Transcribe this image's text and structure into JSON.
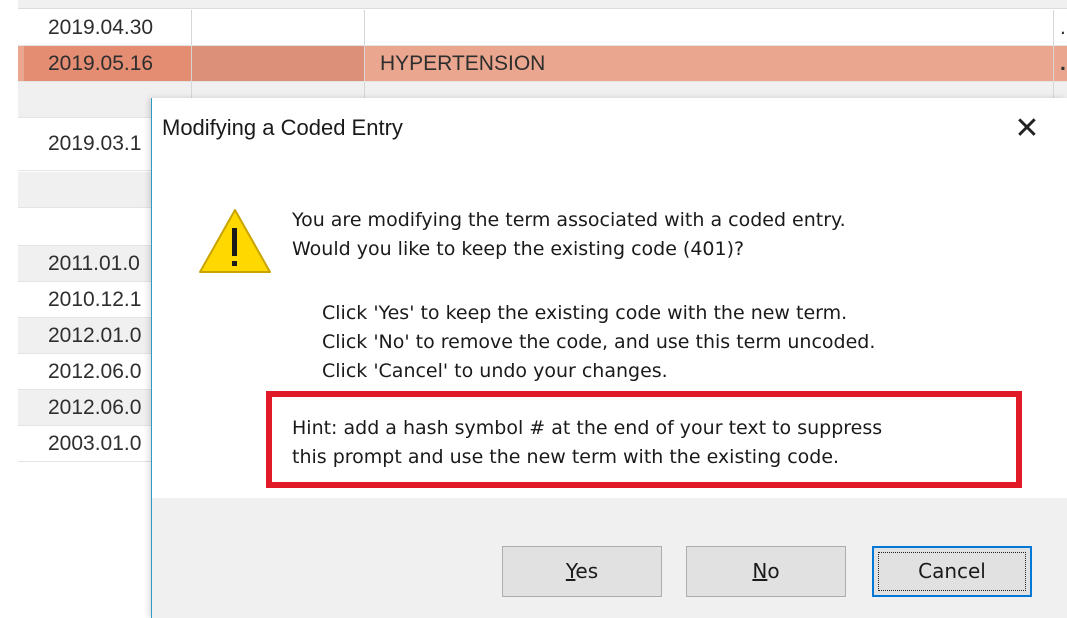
{
  "table": {
    "rows": [
      {
        "date": "2019.04.30",
        "desc": "",
        "more": "...",
        "style": "white"
      },
      {
        "date": "2019.05.16",
        "desc": "HYPERTENSION",
        "more": "...",
        "style": "selected"
      },
      {
        "date": "",
        "desc": "",
        "more": "",
        "style": "gray"
      },
      {
        "date": "2019.03.1",
        "desc": "",
        "more": "",
        "style": "white"
      },
      {
        "date": "",
        "desc": "",
        "more": "",
        "style": "gray"
      },
      {
        "date": "",
        "desc": "",
        "more": "",
        "style": "white"
      },
      {
        "date": "2011.01.0",
        "desc": "",
        "more": "",
        "style": "gray"
      },
      {
        "date": "2010.12.1",
        "desc": "",
        "more": "",
        "style": "white"
      },
      {
        "date": "2012.01.0",
        "desc": "",
        "more": "",
        "style": "gray"
      },
      {
        "date": "2012.06.0",
        "desc": "",
        "more": "",
        "style": "white"
      },
      {
        "date": "2012.06.0",
        "desc": "",
        "more": "",
        "style": "gray"
      },
      {
        "date": "2003.01.0",
        "desc": "",
        "more": "",
        "style": "white"
      }
    ]
  },
  "dialog": {
    "title": "Modifying a Coded Entry",
    "close_icon": "close-icon",
    "warning_icon": "warning-icon",
    "message_line1": "You are modifying the term associated with a coded entry.",
    "message_line2": "Would you like to keep the existing code (401)?",
    "option_yes": "Click 'Yes' to keep the existing code with the new term.",
    "option_no": "Click 'No' to remove the code, and use this term uncoded.",
    "option_cancel": "Click 'Cancel' to undo your changes.",
    "hint_line1": "Hint: add a hash symbol # at the end of your text to suppress",
    "hint_line2": "this prompt and use the new term with the existing code.",
    "buttons": {
      "yes_mnemonic": "Y",
      "yes_rest": "es",
      "no_mnemonic": "N",
      "no_rest": "o",
      "cancel": "Cancel"
    }
  },
  "colors": {
    "selected_row": "#eaa68f",
    "hint_border": "#e01a27",
    "warning_fill": "#ffd800",
    "dialog_accent": "#2f9bc3",
    "default_button_border": "#0078d7"
  }
}
